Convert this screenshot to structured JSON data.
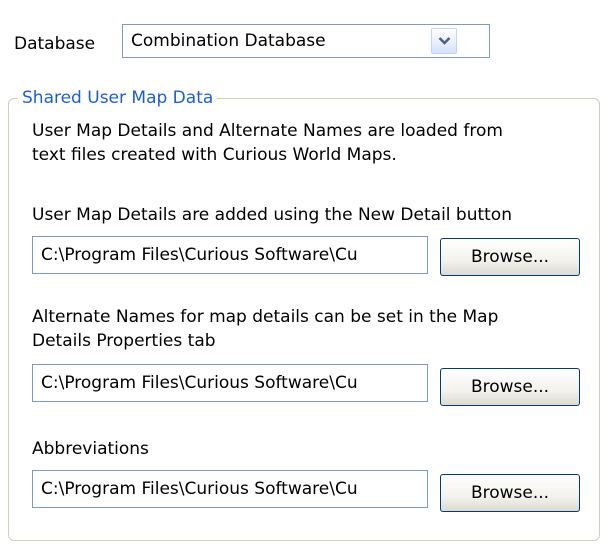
{
  "database": {
    "label": "Database",
    "selected": "Combination Database",
    "dropdown_icon": "chevron-down-icon"
  },
  "shared_group": {
    "title": "Shared User Map Data",
    "intro_line1": "User Map Details and Alternate Names are loaded from",
    "intro_line2": "text files created with Curious World Maps.",
    "details_desc": "User Map Details are added using the New Detail button",
    "details_path": "C:\\Program Files\\Curious Software\\Cu",
    "alt_desc_line1": "Alternate Names for map details can be set in the Map",
    "alt_desc_line2": "Details Properties tab",
    "alt_path": "C:\\Program Files\\Curious Software\\Cu",
    "abbr_desc": "Abbreviations",
    "abbr_path": "C:\\Program Files\\Curious Software\\Cu",
    "browse_label": "Browse..."
  }
}
